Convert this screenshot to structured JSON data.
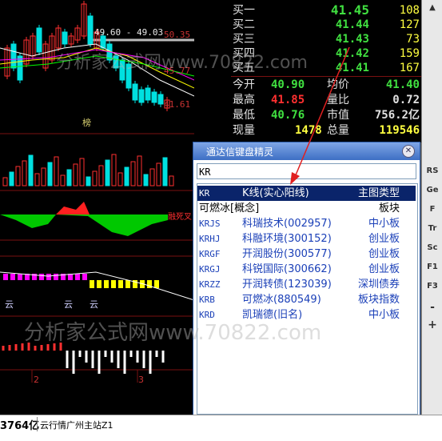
{
  "chart": {
    "range_label": "49.60 - 49.03",
    "price_ticks": [
      "50.35",
      "45.77",
      "41.61"
    ],
    "bang_label": "榜",
    "date_ticks": [
      "2",
      "3"
    ],
    "cloud_labels": [
      "云",
      "云",
      "云"
    ],
    "signal_label": "融死叉"
  },
  "quote": {
    "bids": [
      {
        "label": "买一",
        "price": "41.45",
        "volume": "108"
      },
      {
        "label": "买二",
        "price": "41.44",
        "volume": "127"
      },
      {
        "label": "买三",
        "price": "41.43",
        "volume": "73"
      },
      {
        "label": "买四",
        "price": "41.42",
        "volume": "159"
      },
      {
        "label": "买五",
        "price": "41.41",
        "volume": "167"
      }
    ],
    "stats": [
      {
        "label": "今开",
        "value": "40.90",
        "label2": "均价",
        "value2": "41.40"
      },
      {
        "label": "最高",
        "value": "41.85",
        "label2": "量比",
        "value2": "0.72"
      },
      {
        "label": "最低",
        "value": "40.76",
        "label2": "市值",
        "value2": "756.2亿"
      },
      {
        "label": "现量",
        "value": "1478",
        "label2": "总量",
        "value2": "119546"
      }
    ]
  },
  "toolbar": {
    "items": [
      "RS",
      "Ge",
      "F",
      "Tr",
      "Sc",
      "F1",
      "F3",
      "-",
      "+"
    ]
  },
  "dialog": {
    "title": "通达信键盘精灵",
    "input_value": "KR",
    "items": [
      {
        "code": "KR",
        "name": "K线(实心阳线)",
        "type": "主图类型",
        "selected": true
      },
      {
        "code": "",
        "name": "可燃冰[概念]",
        "type": "板块",
        "dark": true
      },
      {
        "code": "KRJS",
        "name": "科瑞技术(002957)",
        "type": "中小板"
      },
      {
        "code": "KRHJ",
        "name": "科融环境(300152)",
        "type": "创业板"
      },
      {
        "code": "KRGF",
        "name": "开润股份(300577)",
        "type": "创业板"
      },
      {
        "code": "KRGJ",
        "name": "科锐国际(300662)",
        "type": "创业板"
      },
      {
        "code": "KRZZ",
        "name": "开润转债(123039)",
        "type": "深圳债券"
      },
      {
        "code": "KRB",
        "name": "可燃冰(880549)",
        "type": "板块指数"
      },
      {
        "code": "KRD",
        "name": "凯瑞德(旧名)",
        "type": "中小板"
      }
    ]
  },
  "status": {
    "amount": "3764亿",
    "server": "云行情广州主站Z1"
  },
  "watermark": {
    "text1": "分析家公式网www.70822.com",
    "text2": "分析家公式网www.70822.com"
  },
  "colors": {
    "up": "#ff3030",
    "down": "#00e0e0",
    "bid_price": "#40e040",
    "volume": "#ffff40"
  }
}
